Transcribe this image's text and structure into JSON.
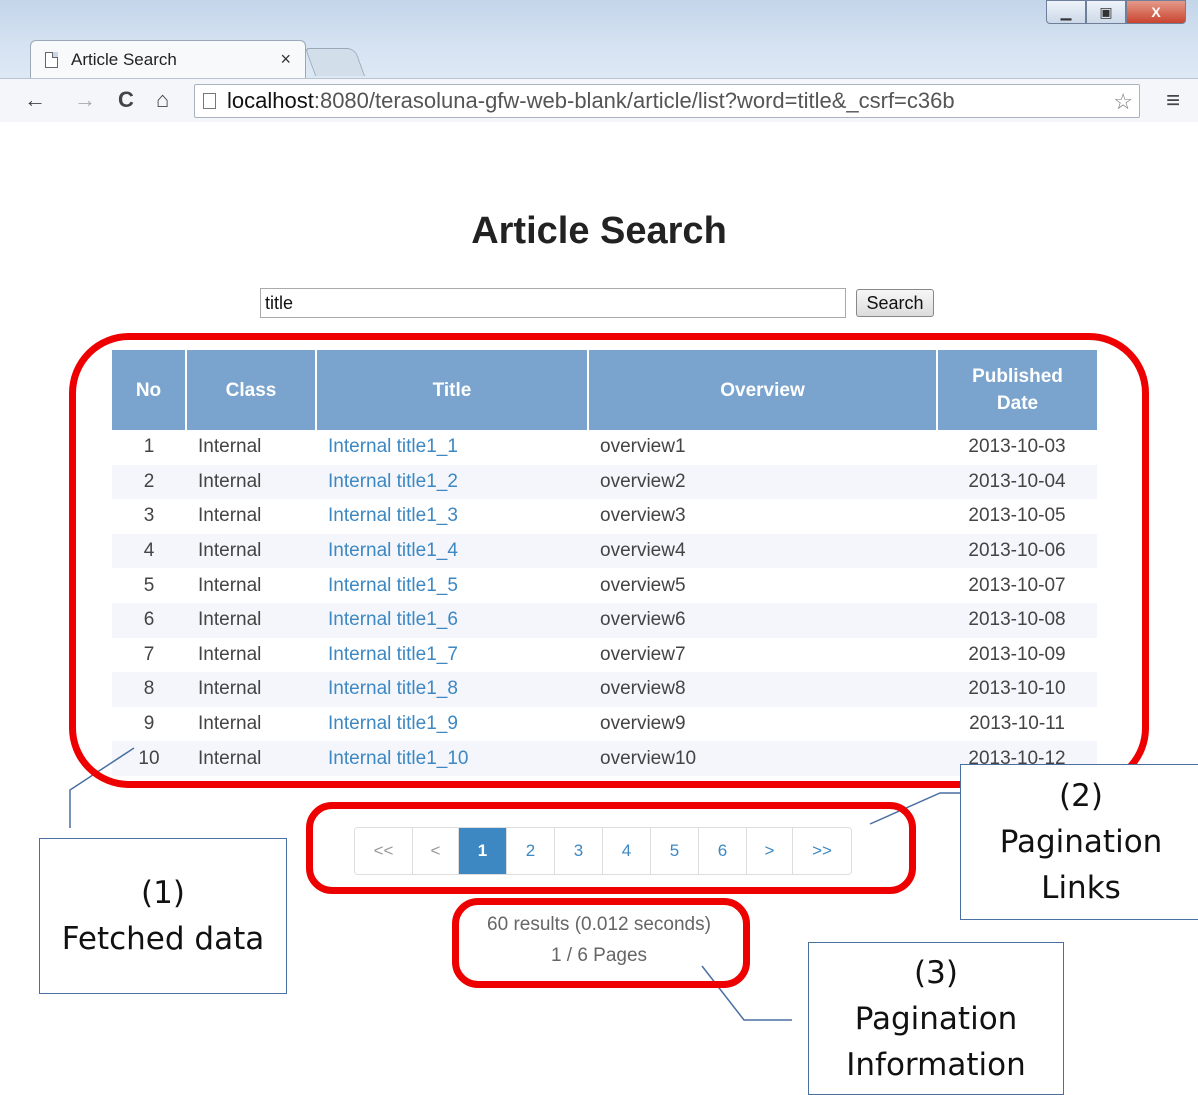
{
  "browser": {
    "tab_title": "Article Search",
    "tab_close": "×",
    "url_host": "localhost",
    "url_rest": ":8080/terasoluna-gfw-web-blank/article/list?word=title&_csrf=c36b",
    "minimize": "▁",
    "maximize": "▣",
    "close": "X",
    "back": "←",
    "forward": "→",
    "reload": "C",
    "home": "⌂",
    "star": "☆",
    "menu": "≡"
  },
  "page": {
    "title": "Article Search",
    "search_value": "title",
    "search_button": "Search"
  },
  "table": {
    "headers": [
      "No",
      "Class",
      "Title",
      "Overview",
      "Published Date"
    ],
    "rows": [
      [
        "1",
        "Internal",
        "Internal title1_1",
        "overview1",
        "2013-10-03"
      ],
      [
        "2",
        "Internal",
        "Internal title1_2",
        "overview2",
        "2013-10-04"
      ],
      [
        "3",
        "Internal",
        "Internal title1_3",
        "overview3",
        "2013-10-05"
      ],
      [
        "4",
        "Internal",
        "Internal title1_4",
        "overview4",
        "2013-10-06"
      ],
      [
        "5",
        "Internal",
        "Internal title1_5",
        "overview5",
        "2013-10-07"
      ],
      [
        "6",
        "Internal",
        "Internal title1_6",
        "overview6",
        "2013-10-08"
      ],
      [
        "7",
        "Internal",
        "Internal title1_7",
        "overview7",
        "2013-10-09"
      ],
      [
        "8",
        "Internal",
        "Internal title1_8",
        "overview8",
        "2013-10-10"
      ],
      [
        "9",
        "Internal",
        "Internal title1_9",
        "overview9",
        "2013-10-11"
      ],
      [
        "10",
        "Internal",
        "Internal title1_10",
        "overview10",
        "2013-10-12"
      ]
    ]
  },
  "pagination": {
    "links": [
      "<<",
      "<",
      "1",
      "2",
      "3",
      "4",
      "5",
      "6",
      ">",
      ">>"
    ],
    "active": "1",
    "disabled": [
      "<<",
      "<"
    ]
  },
  "info": {
    "results": "60 results (0.012 seconds)",
    "pages": "1 / 6 Pages"
  },
  "annotations": {
    "fetched_data": [
      "(1)",
      "Fetched data"
    ],
    "pagination_links": [
      "(2)",
      "Pagination",
      "Links"
    ],
    "pagination_information": [
      "(3)",
      "Pagination",
      "Information"
    ]
  },
  "colors": {
    "header_bg": "#7aa4cd",
    "link": "#3d88c2",
    "highlight": "#ee0000",
    "callout_border": "#4a6fa1"
  }
}
